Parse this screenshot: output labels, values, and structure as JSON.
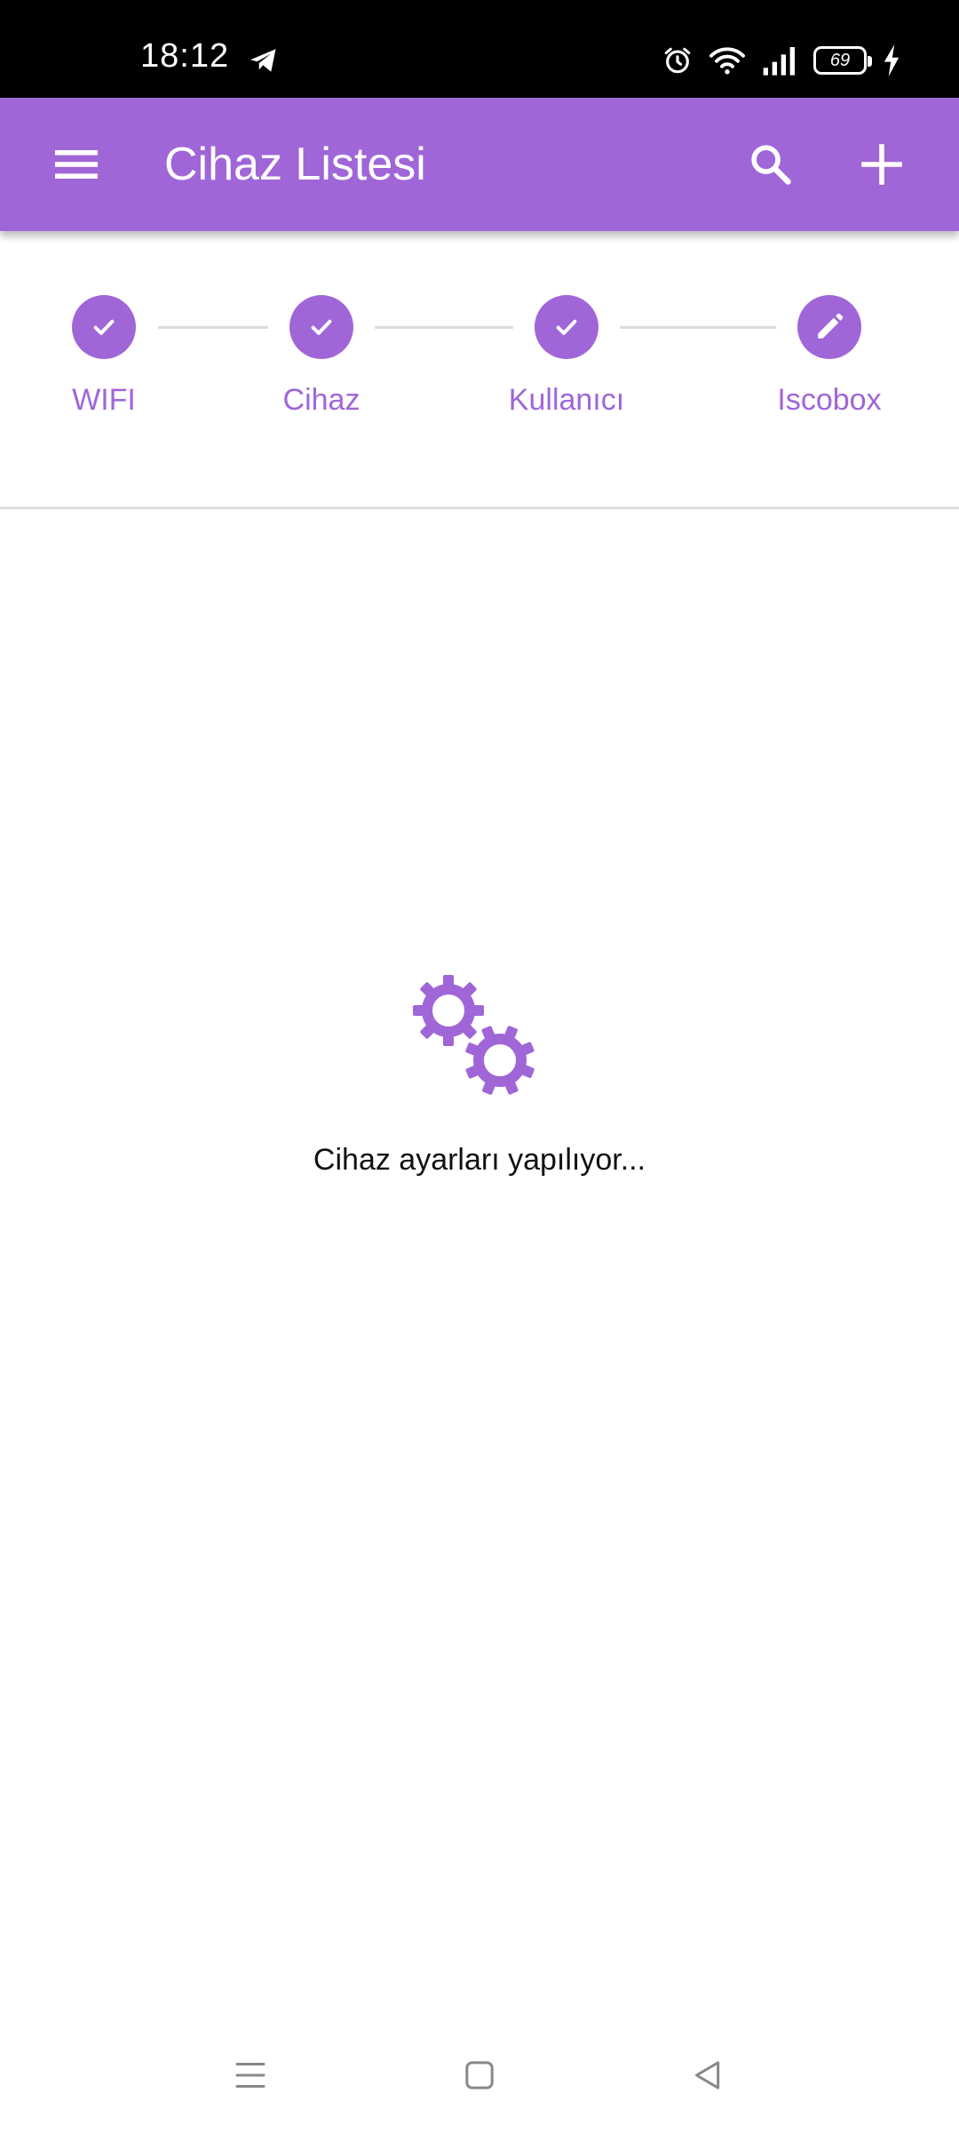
{
  "status_bar": {
    "time": "18:12",
    "battery_level": "69",
    "icons": [
      "telegram-icon",
      "alarm-icon",
      "wifi-icon",
      "signal-icon",
      "battery-icon",
      "charging-bolt-icon"
    ]
  },
  "app_bar": {
    "title": "Cihaz Listesi",
    "icons": [
      "menu-icon",
      "search-icon",
      "add-icon"
    ],
    "background": "#a066d8"
  },
  "stepper": {
    "steps": [
      {
        "label": "WIFI",
        "state": "done",
        "icon": "check-icon"
      },
      {
        "label": "Cihaz",
        "state": "done",
        "icon": "check-icon"
      },
      {
        "label": "Kullanıcı",
        "state": "done",
        "icon": "check-icon"
      },
      {
        "label": "Iscobox",
        "state": "editing",
        "icon": "edit-pencil-icon"
      }
    ],
    "accent": "#a066d8"
  },
  "loading": {
    "icon": "gears-icon",
    "message": "Cihaz ayarları yapılıyor..."
  },
  "nav_bar": {
    "icons": [
      "recent-apps-icon",
      "home-icon",
      "back-icon"
    ]
  }
}
